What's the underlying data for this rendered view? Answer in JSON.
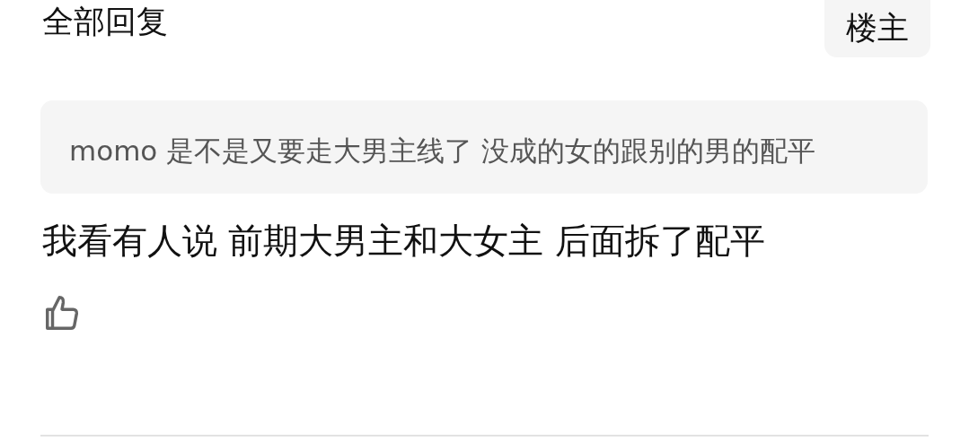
{
  "header": {
    "title": "全部回复",
    "filter_button": {
      "label": "楼主",
      "selected": false
    }
  },
  "reply": {
    "quote": "momo 是不是又要走大男主线了 没成的女的跟别的男的配平",
    "text": "我看有人说 前期大男主和大女主 后面拆了配平",
    "liked": false
  }
}
